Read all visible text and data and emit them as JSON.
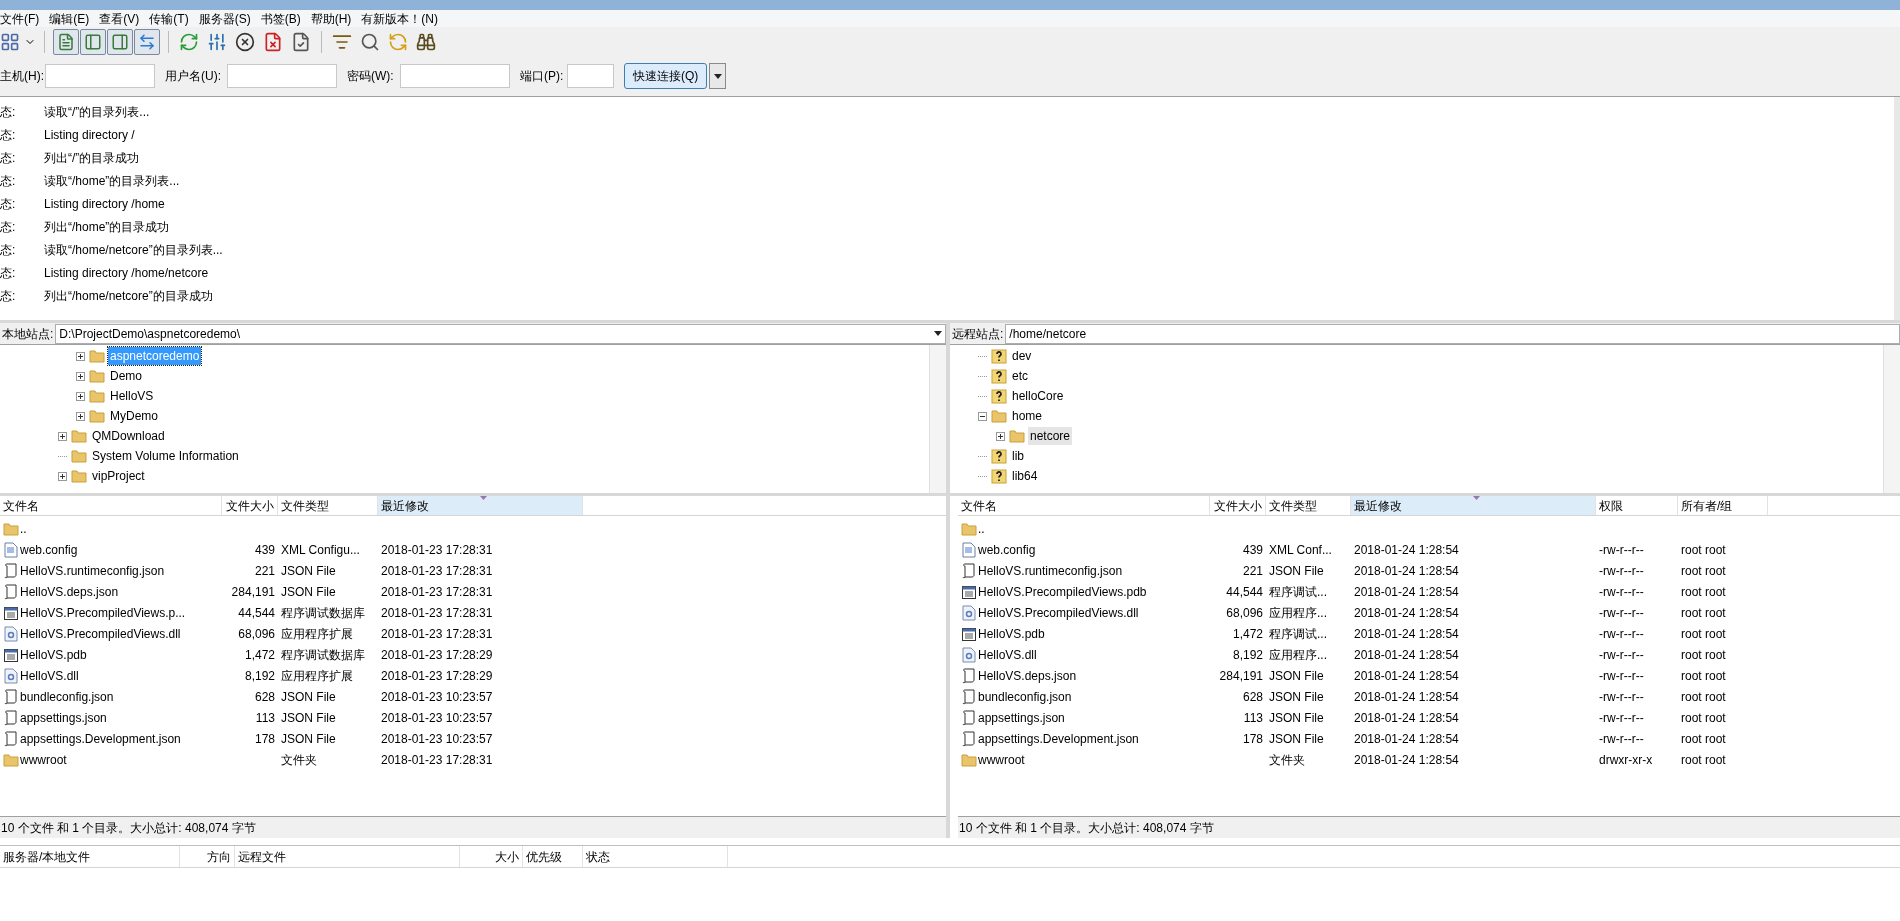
{
  "menu": [
    "文件(F)",
    "编辑(E)",
    "查看(V)",
    "传输(T)",
    "服务器(S)",
    "书签(B)",
    "帮助(H)",
    "有新版本！(N)"
  ],
  "toolbar": {
    "toggles": [
      {
        "pressed": true
      },
      {
        "pressed": true
      },
      {
        "pressed": true
      },
      {
        "pressed": true
      }
    ]
  },
  "quickconnect": {
    "fields": [
      {
        "label": "主机(H):"
      },
      {
        "label": "用户名(U):"
      },
      {
        "label": "密码(W):"
      },
      {
        "label": "端口(P):"
      }
    ],
    "button": "快速连接(Q)"
  },
  "log": [
    {
      "label": "态:",
      "message": "读取“/”的目录列表..."
    },
    {
      "label": "态:",
      "message": "Listing directory /"
    },
    {
      "label": "态:",
      "message": "列出“/”的目录成功"
    },
    {
      "label": "态:",
      "message": "读取“/home”的目录列表..."
    },
    {
      "label": "态:",
      "message": "Listing directory /home"
    },
    {
      "label": "态:",
      "message": "列出“/home”的目录成功"
    },
    {
      "label": "态:",
      "message": "读取“/home/netcore”的目录列表..."
    },
    {
      "label": "态:",
      "message": "Listing directory /home/netcore"
    },
    {
      "label": "态:",
      "message": "列出“/home/netcore”的目录成功"
    }
  ],
  "local": {
    "site_label": "本地站点:",
    "path": "D:\\ProjectDemo\\aspnetcoredemo\\",
    "tree": {
      "focused": true,
      "items": [
        {
          "children": [
            {
              "label": "aspnetcoredemo",
              "kind": "folder",
              "expandable": true,
              "expanded": false,
              "selected": true
            },
            {
              "label": "Demo",
              "kind": "folder",
              "expandable": true,
              "expanded": false,
              "selected": false
            },
            {
              "label": "HelloVS",
              "kind": "folder",
              "expandable": true,
              "expanded": false,
              "selected": false
            },
            {
              "label": "MyDemo",
              "kind": "folder",
              "expandable": true,
              "expanded": false,
              "selected": false
            }
          ]
        },
        {
          "label": "QMDownload",
          "kind": "folder",
          "expandable": true,
          "expanded": false,
          "selected": false
        },
        {
          "label": "System Volume Information",
          "kind": "folder",
          "expandable": false,
          "selected": false
        },
        {
          "label": "vipProject",
          "kind": "folder",
          "expandable": true,
          "expanded": false,
          "selected": false
        }
      ]
    },
    "files": {
      "columns": [
        {
          "label": "文件名",
          "sorted": false
        },
        {
          "label": "文件大小",
          "sorted": false
        },
        {
          "label": "文件类型",
          "sorted": false
        },
        {
          "label": "最近修改",
          "sorted": true
        }
      ],
      "rows": [
        {
          "kind": "folder",
          "cells": [
            ".."
          ]
        },
        {
          "kind": "xml",
          "cells": [
            "web.config",
            "439",
            "XML Configu...",
            "2018-01-23 17:28:31"
          ]
        },
        {
          "kind": "json",
          "cells": [
            "HelloVS.runtimeconfig.json",
            "221",
            "JSON File",
            "2018-01-23 17:28:31"
          ]
        },
        {
          "kind": "json",
          "cells": [
            "HelloVS.deps.json",
            "284,191",
            "JSON File",
            "2018-01-23 17:28:31"
          ]
        },
        {
          "kind": "pdb",
          "cells": [
            "HelloVS.PrecompiledViews.p...",
            "44,544",
            "程序调试数据库",
            "2018-01-23 17:28:31"
          ]
        },
        {
          "kind": "dll",
          "cells": [
            "HelloVS.PrecompiledViews.dll",
            "68,096",
            "应用程序扩展",
            "2018-01-23 17:28:31"
          ]
        },
        {
          "kind": "pdb",
          "cells": [
            "HelloVS.pdb",
            "1,472",
            "程序调试数据库",
            "2018-01-23 17:28:29"
          ]
        },
        {
          "kind": "dll",
          "cells": [
            "HelloVS.dll",
            "8,192",
            "应用程序扩展",
            "2018-01-23 17:28:29"
          ]
        },
        {
          "kind": "json",
          "cells": [
            "bundleconfig.json",
            "628",
            "JSON File",
            "2018-01-23 10:23:57"
          ]
        },
        {
          "kind": "json",
          "cells": [
            "appsettings.json",
            "113",
            "JSON File",
            "2018-01-23 10:23:57"
          ]
        },
        {
          "kind": "json",
          "cells": [
            "appsettings.Development.json",
            "178",
            "JSON File",
            "2018-01-23 10:23:57"
          ]
        },
        {
          "kind": "folder",
          "cells": [
            "wwwroot",
            "",
            "文件夹",
            "2018-01-23 17:28:31"
          ]
        }
      ],
      "status": "10 个文件 和 1 个目录。大小总计: 408,074 字节"
    }
  },
  "remote": {
    "site_label": "远程站点:",
    "path": "/home/netcore",
    "tree": {
      "focused": false,
      "items": [
        {
          "label": "dev",
          "kind": "unknown",
          "expandable": false,
          "selected": false
        },
        {
          "label": "etc",
          "kind": "unknown",
          "expandable": false,
          "selected": false
        },
        {
          "label": "helloCore",
          "kind": "unknown",
          "expandable": false,
          "selected": false
        },
        {
          "label": "home",
          "kind": "folder",
          "expandable": true,
          "expanded": true,
          "selected": false,
          "children": [
            {
              "label": "netcore",
              "kind": "folder",
              "expandable": true,
              "expanded": false,
              "selected": true
            }
          ]
        },
        {
          "label": "lib",
          "kind": "unknown",
          "expandable": false,
          "selected": false
        },
        {
          "label": "lib64",
          "kind": "unknown",
          "expandable": false,
          "selected": false
        }
      ]
    },
    "files": {
      "columns": [
        {
          "label": "文件名",
          "sorted": false
        },
        {
          "label": "文件大小",
          "sorted": false
        },
        {
          "label": "文件类型",
          "sorted": false
        },
        {
          "label": "最近修改",
          "sorted": true
        },
        {
          "label": "权限",
          "sorted": false
        },
        {
          "label": "所有者/组",
          "sorted": false
        }
      ],
      "rows": [
        {
          "kind": "folder",
          "cells": [
            ".."
          ]
        },
        {
          "kind": "xml",
          "cells": [
            "web.config",
            "439",
            "XML Conf...",
            "2018-01-24 1:28:54",
            "-rw-r--r--",
            "root root"
          ]
        },
        {
          "kind": "json",
          "cells": [
            "HelloVS.runtimeconfig.json",
            "221",
            "JSON File",
            "2018-01-24 1:28:54",
            "-rw-r--r--",
            "root root"
          ]
        },
        {
          "kind": "pdb",
          "cells": [
            "HelloVS.PrecompiledViews.pdb",
            "44,544",
            "程序调试...",
            "2018-01-24 1:28:54",
            "-rw-r--r--",
            "root root"
          ]
        },
        {
          "kind": "dll",
          "cells": [
            "HelloVS.PrecompiledViews.dll",
            "68,096",
            "应用程序...",
            "2018-01-24 1:28:54",
            "-rw-r--r--",
            "root root"
          ]
        },
        {
          "kind": "pdb",
          "cells": [
            "HelloVS.pdb",
            "1,472",
            "程序调试...",
            "2018-01-24 1:28:54",
            "-rw-r--r--",
            "root root"
          ]
        },
        {
          "kind": "dll",
          "cells": [
            "HelloVS.dll",
            "8,192",
            "应用程序...",
            "2018-01-24 1:28:54",
            "-rw-r--r--",
            "root root"
          ]
        },
        {
          "kind": "json",
          "cells": [
            "HelloVS.deps.json",
            "284,191",
            "JSON File",
            "2018-01-24 1:28:54",
            "-rw-r--r--",
            "root root"
          ]
        },
        {
          "kind": "json",
          "cells": [
            "bundleconfig.json",
            "628",
            "JSON File",
            "2018-01-24 1:28:54",
            "-rw-r--r--",
            "root root"
          ]
        },
        {
          "kind": "json",
          "cells": [
            "appsettings.json",
            "113",
            "JSON File",
            "2018-01-24 1:28:54",
            "-rw-r--r--",
            "root root"
          ]
        },
        {
          "kind": "json",
          "cells": [
            "appsettings.Development.json",
            "178",
            "JSON File",
            "2018-01-24 1:28:54",
            "-rw-r--r--",
            "root root"
          ]
        },
        {
          "kind": "folder",
          "cells": [
            "wwwroot",
            "",
            "文件夹",
            "2018-01-24 1:28:54",
            "drwxr-xr-x",
            "root root"
          ]
        }
      ],
      "status": "10 个文件 和 1 个目录。大小总计: 408,074 字节"
    }
  },
  "queue": {
    "columns": [
      "服务器/本地文件",
      "方向",
      "远程文件",
      "大小",
      "优先级",
      "状态"
    ]
  }
}
